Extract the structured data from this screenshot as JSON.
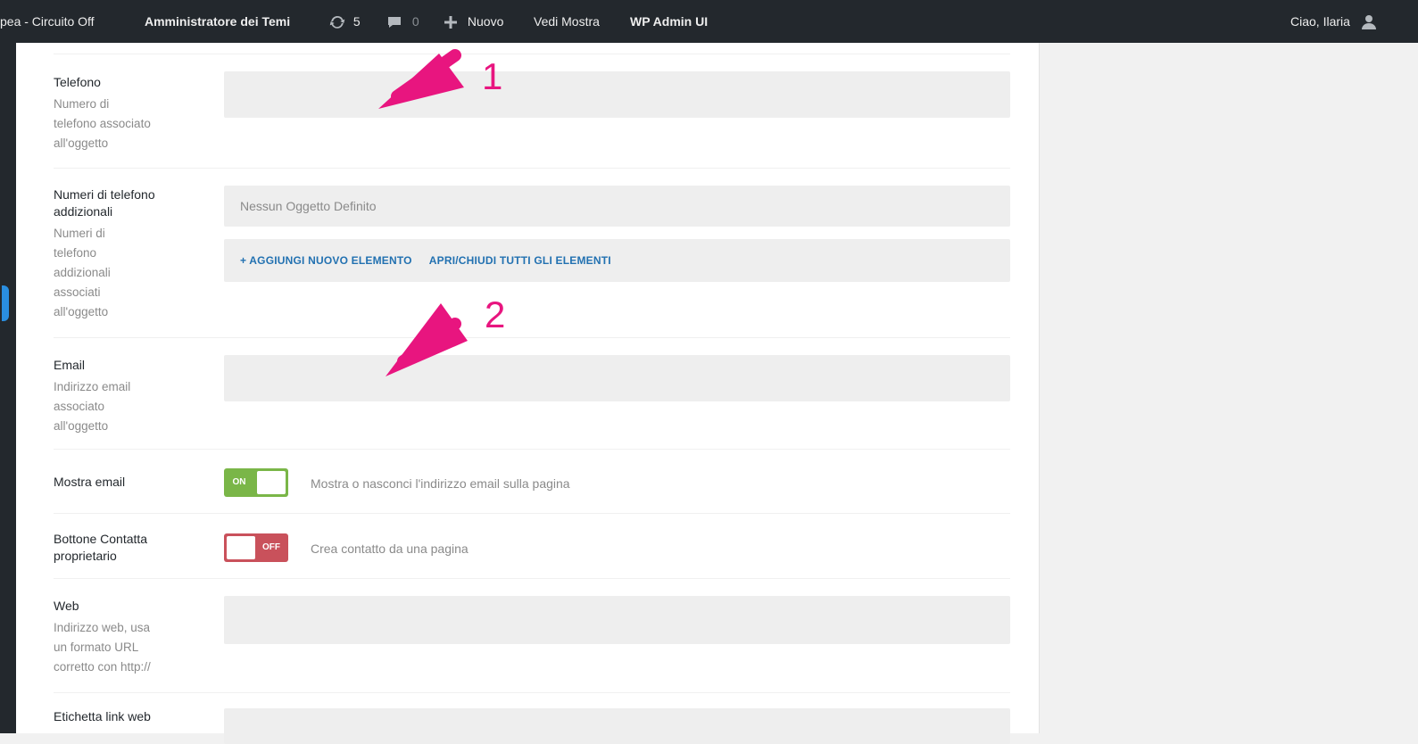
{
  "adminbar": {
    "site_title": "pea - Circuito Off",
    "theme_admin": "Amministratore dei Temi",
    "updates_count": "5",
    "comments_count": "0",
    "new_label": "Nuovo",
    "view_label": "Vedi Mostra",
    "wp_admin_ui": "WP Admin UI",
    "greeting": "Ciao, Ilaria"
  },
  "fields": {
    "phone": {
      "label": "Telefono",
      "desc": [
        "Numero di",
        "telefono associato",
        "all'oggetto"
      ],
      "value": ""
    },
    "extra_phones": {
      "label": [
        "Numeri di telefono",
        "addizionali"
      ],
      "desc": [
        "Numeri di",
        "telefono",
        "addizionali",
        "associati",
        "all'oggetto"
      ],
      "placeholder": "Nessun Oggetto Definito",
      "add_label": "+ AGGIUNGI NUOVO ELEMENTO",
      "toggle_all_label": "APRI/CHIUDI TUTTI GLI ELEMENTI"
    },
    "email": {
      "label": "Email",
      "desc": [
        "Indirizzo email",
        "associato",
        "all'oggetto"
      ],
      "value": ""
    },
    "show_email": {
      "label": "Mostra email",
      "state": "ON",
      "desc": "Mostra o nasconci l'indirizzo email sulla pagina"
    },
    "contact_owner": {
      "label": [
        "Bottone Contatta",
        "proprietario"
      ],
      "state": "OFF",
      "desc": "Crea contatto da una pagina"
    },
    "web": {
      "label": "Web",
      "desc": [
        "Indirizzo web, usa",
        "un formato URL",
        "corretto con http://"
      ],
      "value": ""
    },
    "web_link_label": {
      "label": "Etichetta link web"
    }
  },
  "annotations": {
    "marker1": "1",
    "marker2": "2",
    "color": "#e8157f"
  },
  "colors": {
    "adminbar": "#23282d",
    "toggle_on": "#7ab648",
    "toggle_off": "#c9515b",
    "link": "#2271b1"
  }
}
